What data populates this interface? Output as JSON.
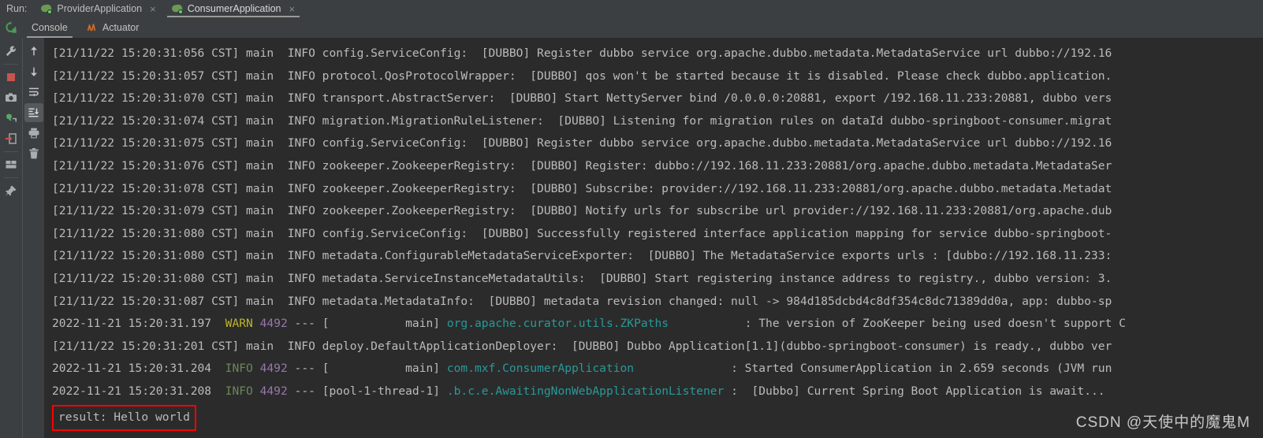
{
  "run_bar": {
    "label": "Run:",
    "tabs": [
      {
        "name": "ProviderApplication",
        "icon": "spring-boot-icon",
        "close": "×",
        "active": false
      },
      {
        "name": "ConsumerApplication",
        "icon": "spring-boot-icon",
        "close": "×",
        "active": true
      }
    ]
  },
  "sub_bar": {
    "rerun_icon": "rerun-icon",
    "tabs": [
      {
        "label": "Console",
        "icon": null,
        "active": true
      },
      {
        "label": "Actuator",
        "icon": "actuator-icon",
        "active": false
      }
    ]
  },
  "left_toolbar": [
    {
      "icon": "wrench-icon",
      "name": "settings"
    },
    {
      "icon": "stop-icon",
      "name": "stop"
    },
    {
      "icon": "camera-icon",
      "name": "camera"
    },
    {
      "icon": "frog-icon",
      "name": "thread-dump"
    },
    {
      "icon": "export-icon",
      "name": "export"
    },
    {
      "icon": "layout-icon",
      "name": "layout"
    },
    {
      "icon": "pin-icon",
      "name": "pin"
    }
  ],
  "mid_toolbar": [
    {
      "icon": "arrow-up-icon",
      "name": "previous-occurrence",
      "selected": false
    },
    {
      "icon": "arrow-down-icon",
      "name": "next-occurrence",
      "selected": false
    },
    {
      "icon": "soft-wrap-icon",
      "name": "soft-wrap",
      "selected": false
    },
    {
      "icon": "scroll-to-end-icon",
      "name": "scroll-to-end",
      "selected": true
    },
    {
      "icon": "print-icon",
      "name": "print",
      "selected": false
    },
    {
      "icon": "trash-icon",
      "name": "clear-all",
      "selected": false
    }
  ],
  "console": {
    "lines": [
      {
        "type": "dubbo",
        "text": "[21/11/22 15:20:31:056 CST] main  INFO config.ServiceConfig:  [DUBBO] Register dubbo service org.apache.dubbo.metadata.MetadataService url dubbo://192.16"
      },
      {
        "type": "dubbo",
        "text": "[21/11/22 15:20:31:057 CST] main  INFO protocol.QosProtocolWrapper:  [DUBBO] qos won't be started because it is disabled. Please check dubbo.application."
      },
      {
        "type": "dubbo",
        "text": "[21/11/22 15:20:31:070 CST] main  INFO transport.AbstractServer:  [DUBBO] Start NettyServer bind /0.0.0.0:20881, export /192.168.11.233:20881, dubbo vers"
      },
      {
        "type": "dubbo",
        "text": "[21/11/22 15:20:31:074 CST] main  INFO migration.MigrationRuleListener:  [DUBBO] Listening for migration rules on dataId dubbo-springboot-consumer.migrat"
      },
      {
        "type": "dubbo",
        "text": "[21/11/22 15:20:31:075 CST] main  INFO config.ServiceConfig:  [DUBBO] Register dubbo service org.apache.dubbo.metadata.MetadataService url dubbo://192.16"
      },
      {
        "type": "dubbo",
        "text": "[21/11/22 15:20:31:076 CST] main  INFO zookeeper.ZookeeperRegistry:  [DUBBO] Register: dubbo://192.168.11.233:20881/org.apache.dubbo.metadata.MetadataSer"
      },
      {
        "type": "dubbo",
        "text": "[21/11/22 15:20:31:078 CST] main  INFO zookeeper.ZookeeperRegistry:  [DUBBO] Subscribe: provider://192.168.11.233:20881/org.apache.dubbo.metadata.Metadat"
      },
      {
        "type": "dubbo",
        "text": "[21/11/22 15:20:31:079 CST] main  INFO zookeeper.ZookeeperRegistry:  [DUBBO] Notify urls for subscribe url provider://192.168.11.233:20881/org.apache.dub"
      },
      {
        "type": "dubbo",
        "text": "[21/11/22 15:20:31:080 CST] main  INFO config.ServiceConfig:  [DUBBO] Successfully registered interface application mapping for service dubbo-springboot-"
      },
      {
        "type": "dubbo",
        "text": "[21/11/22 15:20:31:080 CST] main  INFO metadata.ConfigurableMetadataServiceExporter:  [DUBBO] The MetadataService exports urls : [dubbo://192.168.11.233:"
      },
      {
        "type": "dubbo",
        "text": "[21/11/22 15:20:31:080 CST] main  INFO metadata.ServiceInstanceMetadataUtils:  [DUBBO] Start registering instance address to registry., dubbo version: 3."
      },
      {
        "type": "dubbo",
        "text": "[21/11/22 15:20:31:087 CST] main  INFO metadata.MetadataInfo:  [DUBBO] metadata revision changed: null -> 984d185dcbd4c8df354c8dc71389dd0a, app: dubbo-sp"
      },
      {
        "type": "spring",
        "timestamp": "2022-11-21 15:20:31.197",
        "level": "WARN",
        "level_class": "c-warn",
        "pid": "4492",
        "dashes": "---",
        "thread": "[           main]",
        "logger": "org.apache.curator.utils.ZKPaths",
        "logger_pad": "           ",
        "message": ": The version of ZooKeeper being used doesn't support C"
      },
      {
        "type": "dubbo",
        "text": "[21/11/22 15:20:31:201 CST] main  INFO deploy.DefaultApplicationDeployer:  [DUBBO] Dubbo Application[1.1](dubbo-springboot-consumer) is ready., dubbo ver"
      },
      {
        "type": "spring",
        "timestamp": "2022-11-21 15:20:31.204",
        "level": "INFO",
        "level_class": "c-info",
        "pid": "4492",
        "dashes": "---",
        "thread": "[           main]",
        "logger": "com.mxf.ConsumerApplication",
        "logger_pad": "              ",
        "message": ": Started ConsumerApplication in 2.659 seconds (JVM run"
      },
      {
        "type": "spring",
        "timestamp": "2022-11-21 15:20:31.208",
        "level": "INFO",
        "level_class": "c-info",
        "pid": "4492",
        "dashes": "---",
        "thread": "[pool-1-thread-1]",
        "logger": ".b.c.e.AwaitingNonWebApplicationListener",
        "logger_pad": " ",
        "message": ":  [Dubbo] Current Spring Boot Application is await..."
      }
    ],
    "result": "result: Hello world",
    "result_border_color": "#ff0000"
  },
  "watermark": "CSDN @天使中的魔鬼M"
}
